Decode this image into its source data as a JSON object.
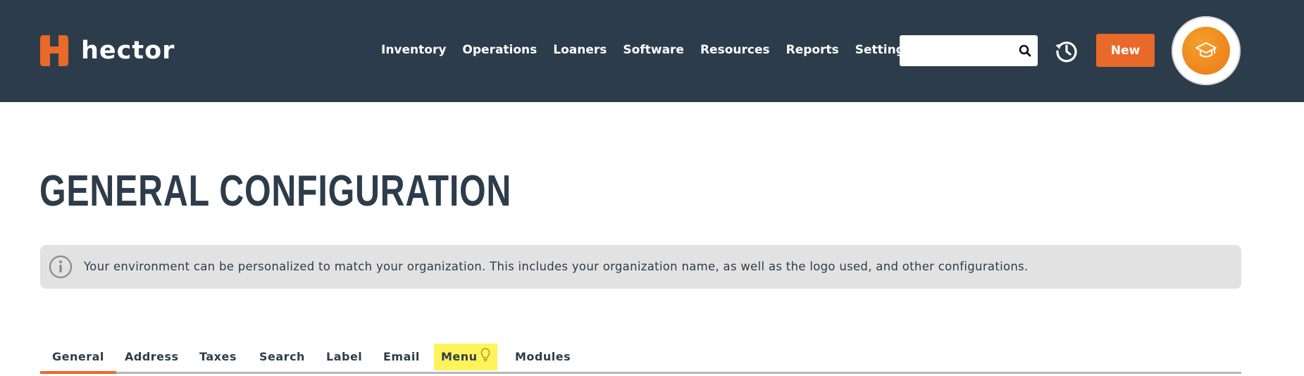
{
  "brand": {
    "name": "hector",
    "accent": "#e8692a",
    "nav_bg": "#2d3c4b"
  },
  "nav": {
    "items": [
      "Inventory",
      "Operations",
      "Loaners",
      "Software",
      "Resources",
      "Reports",
      "Settings"
    ]
  },
  "search": {
    "placeholder": "",
    "value": "",
    "icon": "search-icon"
  },
  "header": {
    "history_icon": "history-icon",
    "new_label": "New",
    "avatar_icon": "graduation-cap-icon"
  },
  "page": {
    "title": "GENERAL CONFIGURATION",
    "info": "Your environment can be personalized to match your organization. This includes your organization name, as well as the logo used, and other configurations."
  },
  "tabs": {
    "items": [
      "General",
      "Address",
      "Taxes",
      "Search",
      "Label",
      "Email",
      "Menu",
      "Modules"
    ],
    "active": "General",
    "highlighted": "Menu",
    "highlight_color": "#fff35c"
  }
}
